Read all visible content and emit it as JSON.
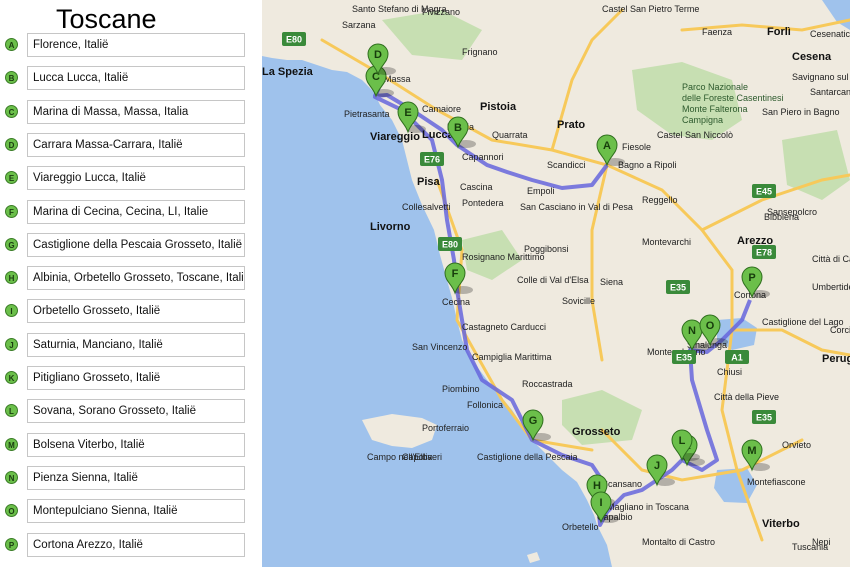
{
  "title": "Toscane",
  "waypoints": [
    {
      "letter": "A",
      "label": "Florence, Italië"
    },
    {
      "letter": "B",
      "label": "Lucca Lucca, Italië"
    },
    {
      "letter": "C",
      "label": "Marina di Massa, Massa, Italia"
    },
    {
      "letter": "D",
      "label": "Carrara Massa-Carrara, Italië"
    },
    {
      "letter": "E",
      "label": "Viareggio Lucca, Italië"
    },
    {
      "letter": "F",
      "label": "Marina di Cecina, Cecina, LI, Italie"
    },
    {
      "letter": "G",
      "label": "Castiglione della Pescaia Grosseto, Italië"
    },
    {
      "letter": "H",
      "label": "Albinia, Orbetello Grosseto, Toscane, Italië"
    },
    {
      "letter": "I",
      "label": "Orbetello Grosseto, Italië"
    },
    {
      "letter": "J",
      "label": "Saturnia, Manciano, Italië"
    },
    {
      "letter": "K",
      "label": "Pitigliano Grosseto, Italië"
    },
    {
      "letter": "L",
      "label": "Sovana, Sorano Grosseto, Italië"
    },
    {
      "letter": "M",
      "label": "Bolsena Viterbo, Italië"
    },
    {
      "letter": "N",
      "label": "Pienza Sienna, Italië"
    },
    {
      "letter": "O",
      "label": "Montepulciano Sienna, Italië"
    },
    {
      "letter": "P",
      "label": "Cortona Arezzo, Italië"
    }
  ],
  "map": {
    "colors": {
      "sea": "#9fc2ec",
      "land": "#efeadf",
      "green": "#c7dfb2",
      "route": "#6666dd",
      "marker": "#6bbf4a",
      "road": "#f7c95a",
      "shield": "#3a8a3a"
    },
    "towns": [
      {
        "name": "Castel San Pietro Terme",
        "kind": "town"
      },
      {
        "name": "Faenza",
        "kind": "town"
      },
      {
        "name": "Forlì",
        "kind": "big"
      },
      {
        "name": "Cesena",
        "kind": "big"
      },
      {
        "name": "Cesenatico",
        "kind": "town"
      },
      {
        "name": "Savignano sul Rubicone",
        "kind": "town"
      },
      {
        "name": "Santarcangelo di Romagna",
        "kind": "town"
      },
      {
        "name": "Parco Nazionale delle Foreste Casentinesi Monte Falterona Campigna",
        "kind": "park"
      },
      {
        "name": "Fivizzano",
        "kind": "town"
      },
      {
        "name": "Santo Stefano di Magra",
        "kind": "town"
      },
      {
        "name": "Sarzana",
        "kind": "town"
      },
      {
        "name": "La Spezia",
        "kind": "big"
      },
      {
        "name": "Massa",
        "kind": "town"
      },
      {
        "name": "Pietrasanta",
        "kind": "town"
      },
      {
        "name": "Camaiore",
        "kind": "town"
      },
      {
        "name": "Viareggio",
        "kind": "big"
      },
      {
        "name": "Lucca",
        "kind": "big"
      },
      {
        "name": "Pescia",
        "kind": "town"
      },
      {
        "name": "Pistoia",
        "kind": "big"
      },
      {
        "name": "Prato",
        "kind": "big"
      },
      {
        "name": "Quarrata",
        "kind": "town"
      },
      {
        "name": "Capannori",
        "kind": "town"
      },
      {
        "name": "Fiesole",
        "kind": "town"
      },
      {
        "name": "Bagno a Ripoli",
        "kind": "town"
      },
      {
        "name": "Scandicci",
        "kind": "town"
      },
      {
        "name": "Empoli",
        "kind": "town"
      },
      {
        "name": "Pisa",
        "kind": "big"
      },
      {
        "name": "Cascina",
        "kind": "town"
      },
      {
        "name": "Pontedera",
        "kind": "town"
      },
      {
        "name": "Collesalvetti",
        "kind": "town"
      },
      {
        "name": "Livorno",
        "kind": "big"
      },
      {
        "name": "San Casciano in Val di Pesa",
        "kind": "town"
      },
      {
        "name": "Poggibonsi",
        "kind": "town"
      },
      {
        "name": "Colle di Val d'Elsa",
        "kind": "town"
      },
      {
        "name": "Siena",
        "kind": "town"
      },
      {
        "name": "Sovicille",
        "kind": "town"
      },
      {
        "name": "Montevarchi",
        "kind": "town"
      },
      {
        "name": "Reggello",
        "kind": "town"
      },
      {
        "name": "Arezzo",
        "kind": "big"
      },
      {
        "name": "Bibbiena",
        "kind": "town"
      },
      {
        "name": "Sansepolcro",
        "kind": "town"
      },
      {
        "name": "Città di Castello",
        "kind": "town"
      },
      {
        "name": "Umbertide",
        "kind": "town"
      },
      {
        "name": "Cortona",
        "kind": "town"
      },
      {
        "name": "Castiglione del Lago",
        "kind": "town"
      },
      {
        "name": "Perugia",
        "kind": "big"
      },
      {
        "name": "Corciano",
        "kind": "town"
      },
      {
        "name": "Sinalunga",
        "kind": "town"
      },
      {
        "name": "Montepulciano",
        "kind": "town"
      },
      {
        "name": "Chiusi",
        "kind": "town"
      },
      {
        "name": "Città della Pieve",
        "kind": "town"
      },
      {
        "name": "Rosignano Marittimo",
        "kind": "town"
      },
      {
        "name": "Cecina",
        "kind": "town"
      },
      {
        "name": "Castagneto Carducci",
        "kind": "town"
      },
      {
        "name": "San Vincenzo",
        "kind": "town"
      },
      {
        "name": "Campiglia Marittima",
        "kind": "town"
      },
      {
        "name": "Roccastrada",
        "kind": "town"
      },
      {
        "name": "Piombino",
        "kind": "town"
      },
      {
        "name": "Follonica",
        "kind": "town"
      },
      {
        "name": "Portoferraio",
        "kind": "town"
      },
      {
        "name": "Campo nell'Elba",
        "kind": "town"
      },
      {
        "name": "Capoliveri",
        "kind": "town"
      },
      {
        "name": "Castiglione della Pescaia",
        "kind": "town"
      },
      {
        "name": "Grosseto",
        "kind": "big"
      },
      {
        "name": "Scansano",
        "kind": "town"
      },
      {
        "name": "Magliano in Toscana",
        "kind": "town"
      },
      {
        "name": "Orbetello",
        "kind": "town"
      },
      {
        "name": "Capalbio",
        "kind": "town"
      },
      {
        "name": "Montalto di Castro",
        "kind": "town"
      },
      {
        "name": "Orvieto",
        "kind": "town"
      },
      {
        "name": "Montefiascone",
        "kind": "town"
      },
      {
        "name": "Viterbo",
        "kind": "big"
      },
      {
        "name": "Tuscania",
        "kind": "town"
      },
      {
        "name": "Nepi",
        "kind": "town"
      },
      {
        "name": "Frignano",
        "kind": "town"
      },
      {
        "name": "San Piero in Bagno",
        "kind": "town"
      },
      {
        "name": "Castel San Niccolò",
        "kind": "town"
      }
    ],
    "shields": [
      "E80",
      "E76",
      "E80",
      "E35",
      "E45",
      "E78",
      "E35",
      "A1",
      "E35"
    ]
  }
}
